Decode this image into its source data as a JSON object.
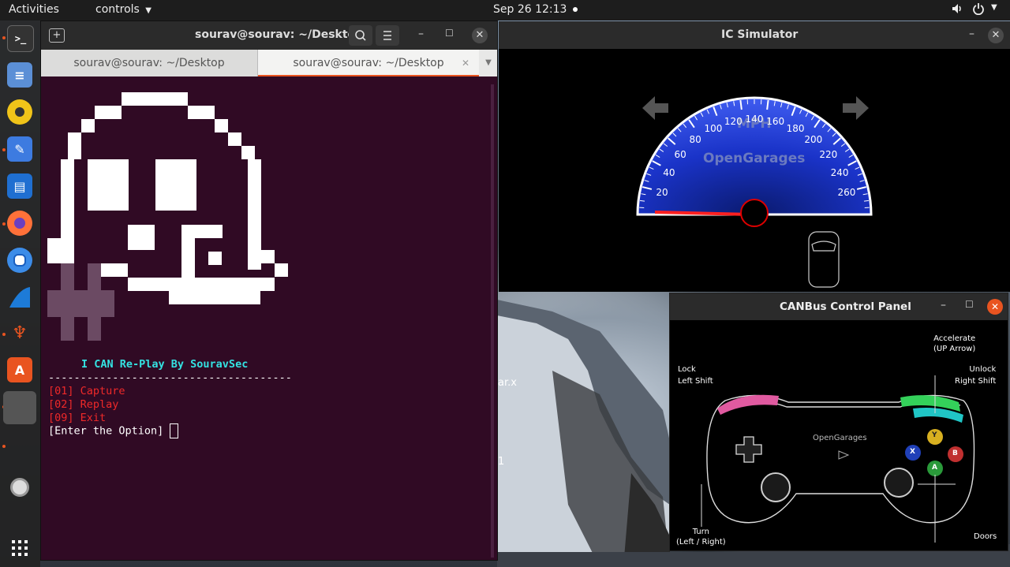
{
  "topbar": {
    "activities": "Activities",
    "app_menu": "controls",
    "datetime": "Sep 26  12:13"
  },
  "dock": {
    "items": [
      "terminal-icon",
      "files-icon",
      "rhythmbox-icon",
      "text-editor-icon",
      "document-icon",
      "firefox-icon",
      "chromium-icon",
      "wireshark-icon",
      "ubuntu-software-icon",
      "app-icon",
      "disc-icon",
      "show-apps-icon"
    ]
  },
  "terminal": {
    "title": "sourav@sourav: ~/Desktop",
    "tabs": [
      {
        "label": "sourav@sourav: ~/Desktop"
      },
      {
        "label": "sourav@sourav: ~/Desktop"
      }
    ],
    "banner": "I CAN Re-Play By SouravSec",
    "separator": "--------------------------------------",
    "options": [
      "[01] Capture",
      "[02] Replay",
      "[09] Exit"
    ],
    "prompt": "[Enter the Option] "
  },
  "ic_simulator": {
    "title": "IC Simulator",
    "speed_unit": "MPH",
    "brand": "OpenGarages",
    "ticks": [
      "20",
      "40",
      "60",
      "80",
      "100",
      "120",
      "140",
      "160",
      "180",
      "200",
      "220",
      "240",
      "260"
    ],
    "speed_value": 0
  },
  "can_panel": {
    "title": "CANBus Control Panel",
    "labels": {
      "accelerate": "Accelerate",
      "accelerate_key": "(UP Arrow)",
      "lock": "Lock",
      "lock_key": "Left Shift",
      "unlock": "Unlock",
      "unlock_key": "Right Shift",
      "turn": "Turn",
      "turn_key": "(Left / Right)",
      "doors": "Doors",
      "brand": "OpenGarages"
    },
    "buttons": {
      "y": "Y",
      "b": "B",
      "x": "X",
      "a": "A"
    }
  },
  "desktop": {
    "file_label_1": "ar.x",
    "file_label_2": "1"
  },
  "colors": {
    "terminal_bg": "#300a24",
    "menu_red": "#ef2929",
    "banner_teal": "#34e2e2",
    "ubuntu_orange": "#e95420"
  }
}
